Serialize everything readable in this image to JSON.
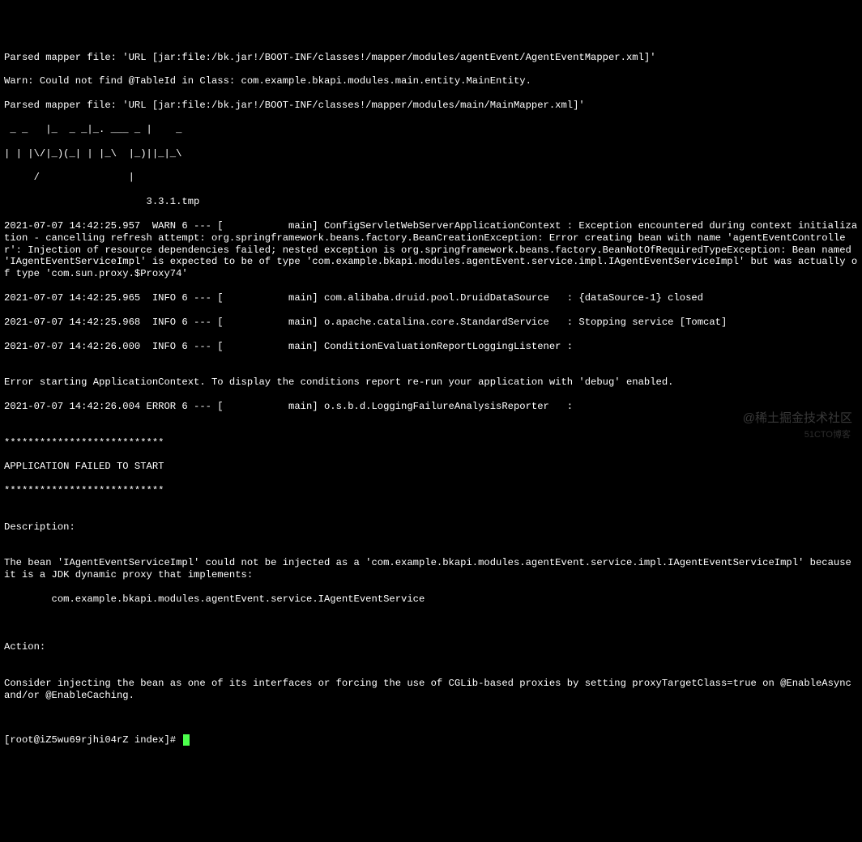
{
  "log": {
    "l1": "Parsed mapper file: 'URL [jar:file:/bk.jar!/BOOT-INF/classes!/mapper/modules/agentEvent/AgentEventMapper.xml]'",
    "l2": "Warn: Could not find @TableId in Class: com.example.bkapi.modules.main.entity.MainEntity.",
    "l3": "Parsed mapper file: 'URL [jar:file:/bk.jar!/BOOT-INF/classes!/mapper/modules/main/MainMapper.xml]'",
    "ascii1": " _ _   |_  _ _|_. ___ _ |    _ ",
    "ascii2": "| | |\\/|_)(_| | |_\\  |_)||_|_\\ ",
    "ascii3": "     /               |         ",
    "ascii4": "                        3.3.1.tmp ",
    "l4": "2021-07-07 14:42:25.957  WARN 6 --- [           main] ConfigServletWebServerApplicationContext : Exception encountered during context initialization - cancelling refresh attempt: org.springframework.beans.factory.BeanCreationException: Error creating bean with name 'agentEventController': Injection of resource dependencies failed; nested exception is org.springframework.beans.factory.BeanNotOfRequiredTypeException: Bean named 'IAgentEventServiceImpl' is expected to be of type 'com.example.bkapi.modules.agentEvent.service.impl.IAgentEventServiceImpl' but was actually of type 'com.sun.proxy.$Proxy74'",
    "l5": "2021-07-07 14:42:25.965  INFO 6 --- [           main] com.alibaba.druid.pool.DruidDataSource   : {dataSource-1} closed",
    "l6": "2021-07-07 14:42:25.968  INFO 6 --- [           main] o.apache.catalina.core.StandardService   : Stopping service [Tomcat]",
    "l7": "2021-07-07 14:42:26.000  INFO 6 --- [           main] ConditionEvaluationReportLoggingListener : ",
    "l8": "",
    "l9": "Error starting ApplicationContext. To display the conditions report re-run your application with 'debug' enabled.",
    "l10": "2021-07-07 14:42:26.004 ERROR 6 --- [           main] o.s.b.d.LoggingFailureAnalysisReporter   : ",
    "l11": "",
    "l12": "***************************",
    "l13": "APPLICATION FAILED TO START",
    "l14": "***************************",
    "l15": "",
    "l16": "Description:",
    "l17": "",
    "l18": "The bean 'IAgentEventServiceImpl' could not be injected as a 'com.example.bkapi.modules.agentEvent.service.impl.IAgentEventServiceImpl' because it is a JDK dynamic proxy that implements:",
    "l19": "\tcom.example.bkapi.modules.agentEvent.service.IAgentEventService",
    "l20": "",
    "l21": "",
    "l22": "Action:",
    "l23": "",
    "l24": "Consider injecting the bean as one of its interfaces or forcing the use of CGLib-based proxies by setting proxyTargetClass=true on @EnableAsync and/or @EnableCaching.",
    "prompt": "[root@iZ5wu69rjhi04rZ index]# "
  },
  "watermark": {
    "top": "@稀土掘金技术社区",
    "bottom": "51CTO博客"
  }
}
